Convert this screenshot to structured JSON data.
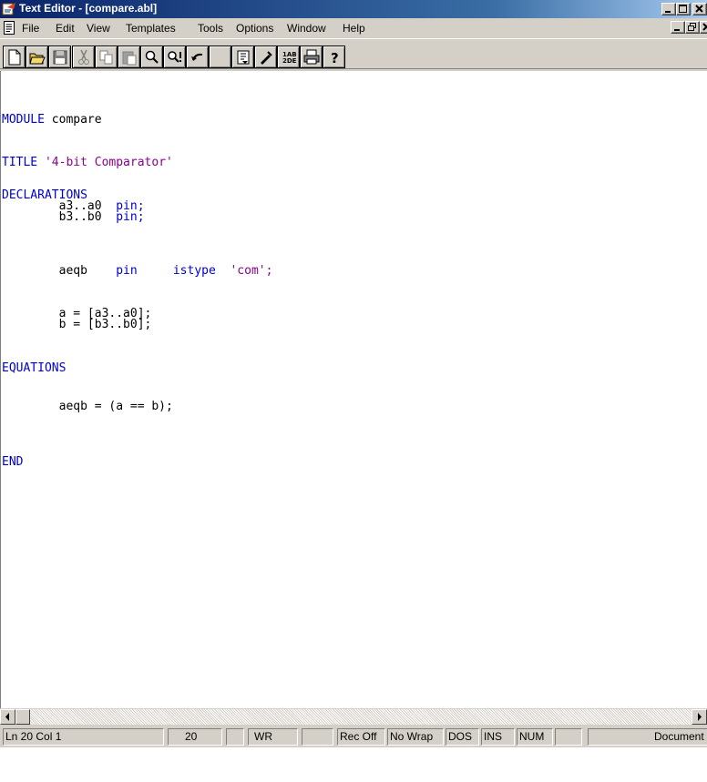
{
  "window": {
    "title": "Text Editor - [compare.abl]"
  },
  "menu": {
    "items": [
      "File",
      "Edit",
      "View",
      "Templates",
      "Tools",
      "Options",
      "Window",
      "Help"
    ]
  },
  "toolbar": {
    "buttons": [
      "new-file-icon",
      "open-folder-icon",
      "save-icon",
      "cut-icon",
      "copy-icon",
      "paste-icon",
      "find-icon",
      "find-next-icon",
      "undo-icon",
      "blank-icon",
      "insert-file-icon",
      "edit-tool-icon",
      "sort-icon",
      "print-icon",
      "help-icon"
    ]
  },
  "editor": {
    "lines": [
      [
        "MODULE",
        " compare"
      ],
      [
        "TITLE",
        " '4-bit Comparator'"
      ],
      [
        "DECLARATIONS"
      ],
      [
        "        a3..a0  ",
        "pin;"
      ],
      [
        "        b3..b0  ",
        "pin;"
      ],
      [
        "        aeqb    ",
        "pin",
        "     istype  ",
        "'com';"
      ],
      [
        "        a = [a3..a0];"
      ],
      [
        "        b = [b3..b0];"
      ],
      [
        "EQUATIONS"
      ],
      [
        "        aeqb = (a == b);"
      ],
      [
        "END"
      ]
    ]
  },
  "status": {
    "position": "Ln 20 Col 1",
    "line_count": "20",
    "write_mode": "WR",
    "record": "Rec Off",
    "wrap": "No Wrap",
    "format": "DOS",
    "insert": "INS",
    "num": "NUM",
    "doc": "Document"
  },
  "colors": {
    "keyword": "#0000cc",
    "string": "#8b008b",
    "titlebar": "#0a246a"
  }
}
